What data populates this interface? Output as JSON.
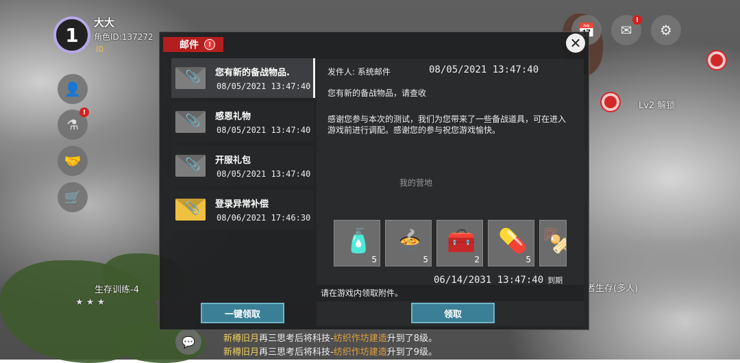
{
  "player": {
    "level": "1",
    "name": "大大",
    "id_label": "角色ID:137272",
    "rank": "I0"
  },
  "map": {
    "labels": [
      "Lv2 解锁",
      "生存训练-4",
      "者生存(多人)",
      "我的营地"
    ],
    "stars": "★ ★ ★"
  },
  "chat": [
    {
      "who": "新樽旧月",
      "text": "再三思考后将科技-",
      "tech": "纺织作坊建造",
      "tail": "升到了8级。"
    },
    {
      "who": "新樽旧月",
      "text": "再三思考后将科技-",
      "tech": "纺织作坊建造",
      "tail": "升到了9级。"
    }
  ],
  "mail": {
    "tab_label": "邮件",
    "tab_badge": "!",
    "close_glyph": "✕",
    "list": [
      {
        "title": "您有新的备战物品.",
        "date": "08/05/2021 13:47:40",
        "icon": "grey"
      },
      {
        "title": "感恩礼物",
        "date": "08/05/2021 13:47:40",
        "icon": "grey"
      },
      {
        "title": "开服礼包",
        "date": "08/05/2021 13:47:40",
        "icon": "grey"
      },
      {
        "title": "登录异常补偿",
        "date": "08/06/2021 17:46:30",
        "icon": "gold"
      }
    ],
    "detail": {
      "sender_label": "发件人: 系统邮件",
      "time": "08/05/2021 13:47:40",
      "subject": "您有新的备战物品，请查收",
      "body": "感谢您参与本次的测试，我们为您带来了一些备战道具，可在进入游戏前进行调配。感谢您的参与祝您游戏愉快。",
      "attachments": [
        {
          "icon": "water-bottle-icon",
          "glyph": "🧴",
          "count": "5"
        },
        {
          "icon": "soup-bowl-icon",
          "glyph": "🍲",
          "count": "5"
        },
        {
          "icon": "first-aid-kit-icon",
          "glyph": "🧰",
          "count": "2"
        },
        {
          "icon": "pills-icon",
          "glyph": "💊",
          "count": "5"
        },
        {
          "icon": "food-skewer-icon",
          "glyph": "🍢",
          "count": ""
        }
      ],
      "expire_date": "06/14/2031 13:47:40",
      "expire_suffix": "到期",
      "hint": "请在游戏内领取附件。"
    },
    "claim_all_label": "一键领取",
    "claim_label": "领取"
  }
}
